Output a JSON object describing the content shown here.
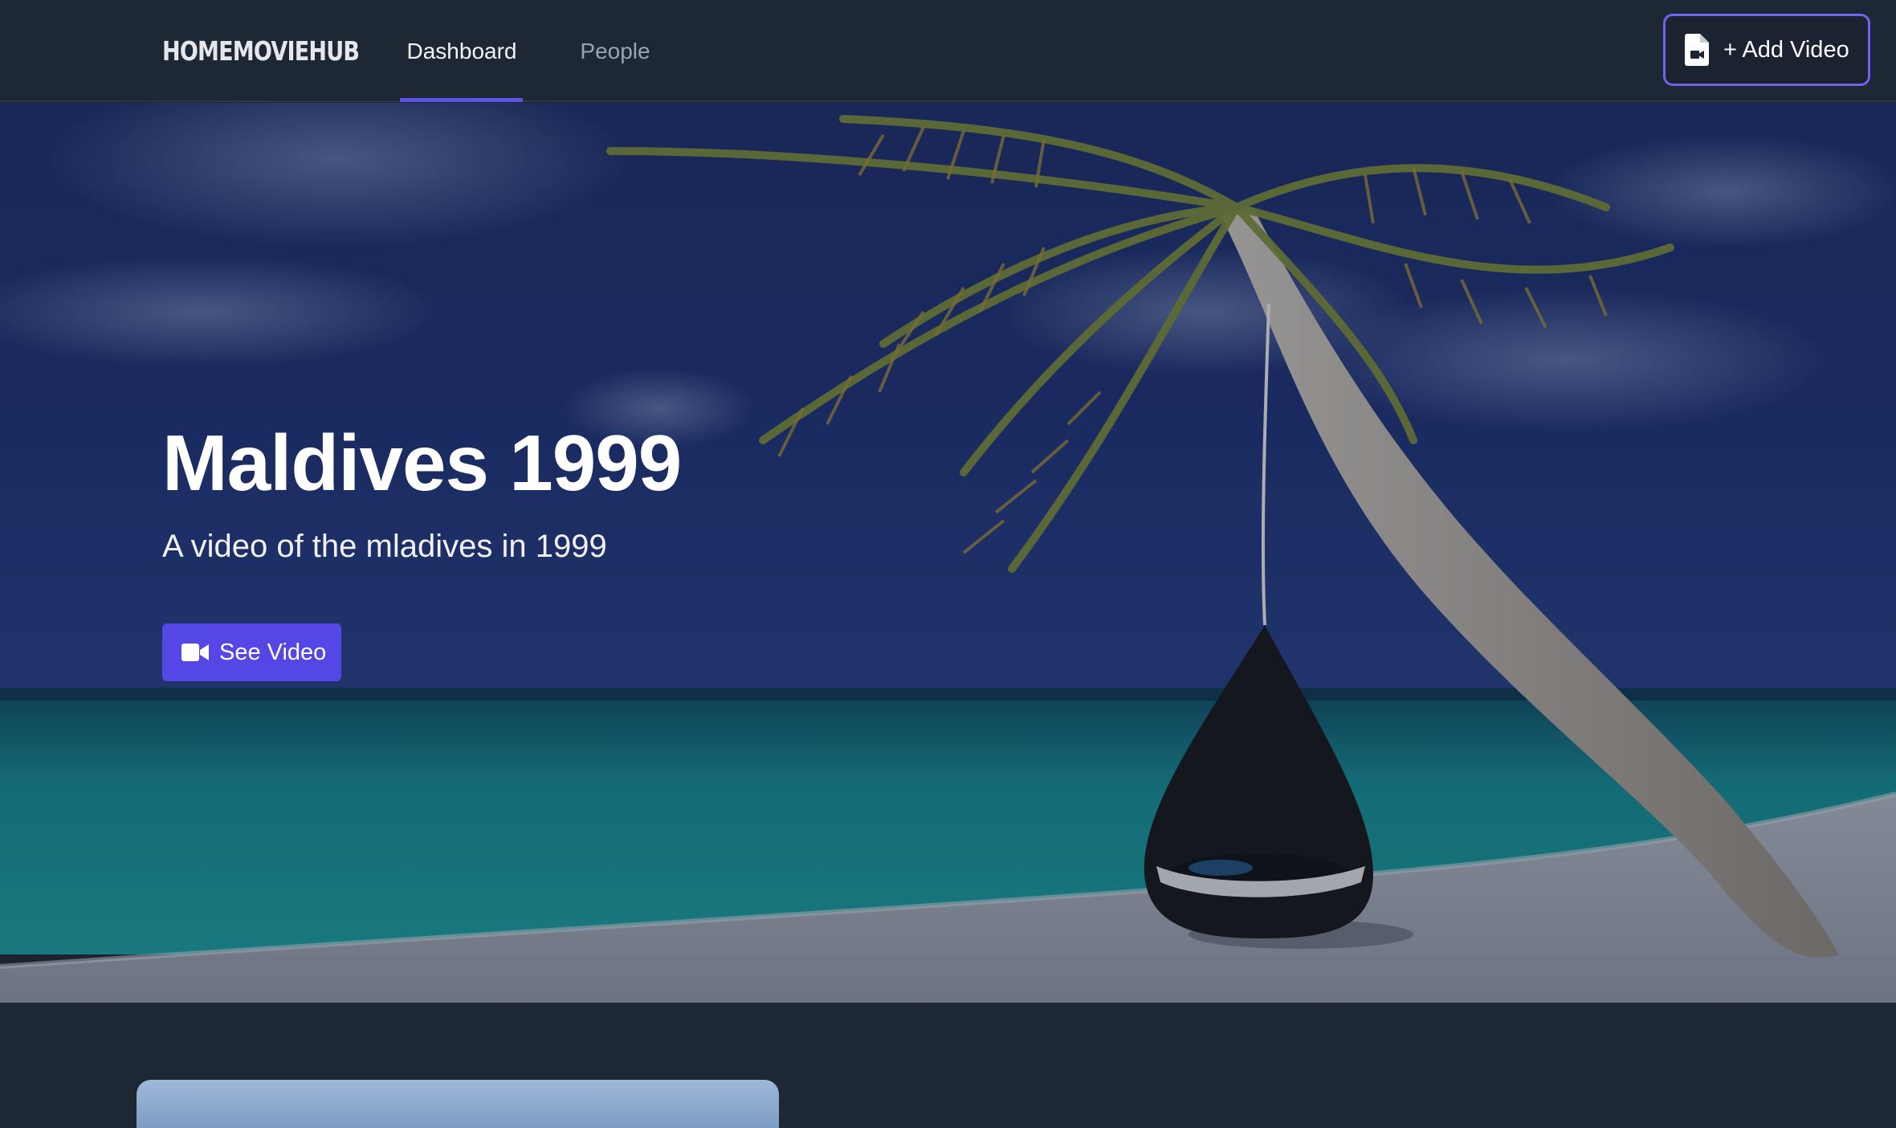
{
  "navbar": {
    "brand": "HOMEMOVIEHUB",
    "tabs": [
      {
        "label": "Dashboard",
        "active": true
      },
      {
        "label": "People",
        "active": false
      }
    ],
    "add_button": {
      "label": "+ Add Video",
      "icon": "file-video-icon"
    }
  },
  "hero": {
    "title": "Maldives 1999",
    "subtitle": "A video of the mladives in 1999",
    "button": {
      "label": "See Video",
      "icon": "video-camera-icon"
    }
  },
  "colors": {
    "background": "#1e2734",
    "accent": "#5447e6",
    "accent_border": "#6f63f0",
    "text": "#ffffff"
  }
}
